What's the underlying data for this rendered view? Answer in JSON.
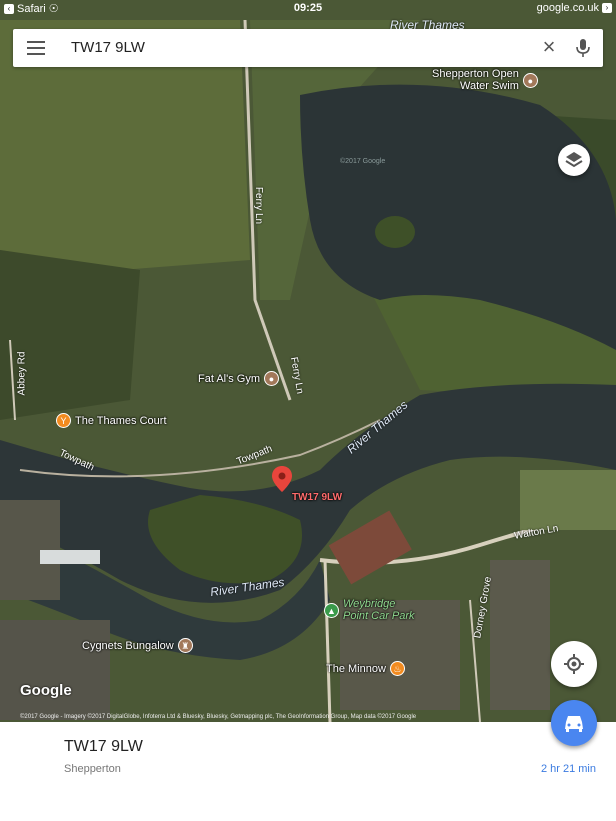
{
  "status_bar": {
    "back_app": "Safari",
    "time": "09:25",
    "url": "google.co.uk"
  },
  "search": {
    "query": "TW17 9LW"
  },
  "map": {
    "pin_label": "TW17 9LW",
    "poi": [
      {
        "name": "Shepperton Open\nWater Swim",
        "icon": "landmark-icon"
      },
      {
        "name": "Fat Al's Gym",
        "icon": "gym-icon"
      },
      {
        "name": "The Thames Court",
        "icon": "bar-icon"
      },
      {
        "name": "Weybridge\nPoint Car Park",
        "icon": "park-icon"
      },
      {
        "name": "Cygnets Bungalow",
        "icon": "landmark-icon"
      },
      {
        "name": "The Minnow",
        "icon": "restaurant-icon"
      }
    ],
    "roads": [
      "Ferry Ln",
      "Ferry Ln",
      "Abbey Rd",
      "Towpath",
      "Towpath",
      "Walton Ln",
      "Dorney Grove"
    ],
    "rivers": [
      "River Thames",
      "River Thames",
      "River Thames"
    ],
    "watermark": "©2017 Google",
    "logo": "Google",
    "attribution": "©2017 Google - Imagery ©2017 DigitalGlobe, Infoterra Ltd & Bluesky, Bluesky, Getmapping plc, The GeoInformation Group, Map data ©2017 Google",
    "colors": {
      "water": "#2b3436",
      "land": "#4a5a35",
      "pin": "#e8453c",
      "accent": "#4a86f0"
    }
  },
  "place_sheet": {
    "title": "TW17 9LW",
    "subtitle": "Shepperton",
    "eta": "2 hr 21 min"
  }
}
